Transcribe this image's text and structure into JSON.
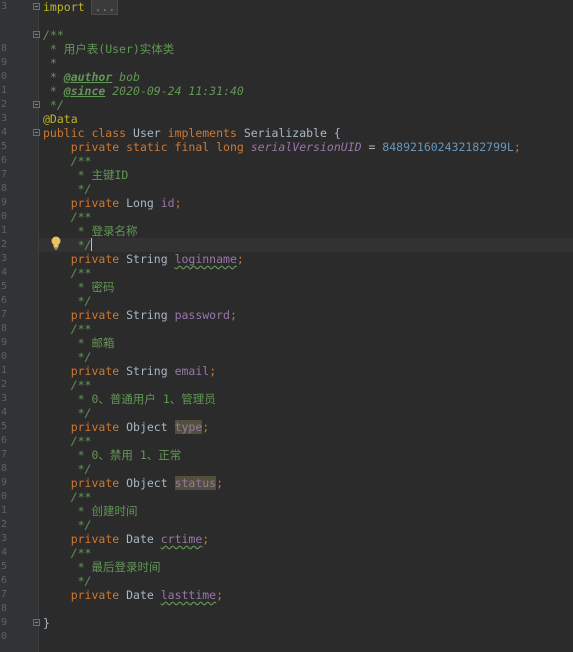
{
  "editor": {
    "line_numbers": [
      "3",
      "",
      "",
      "8",
      "9",
      "0",
      "1",
      "2",
      "3",
      "4",
      "5",
      "6",
      "7",
      "8",
      "9",
      "0",
      "1",
      "2",
      "3",
      "4",
      "5",
      "6",
      "7",
      "8",
      "9",
      "0",
      "1",
      "2",
      "3",
      "4",
      "5",
      "6",
      "7",
      "8",
      "9",
      "0",
      "1",
      "2",
      "3",
      "4",
      "5",
      "6",
      "7",
      "8",
      "9",
      "0"
    ],
    "colors": {
      "background": "#2b2b2b",
      "keyword": "#cc7832",
      "annotation": "#bbb529",
      "doc_comment": "#629755",
      "field": "#9876aa",
      "number": "#6897bb"
    }
  },
  "code": {
    "import_kw": "import",
    "import_fold": "...",
    "doc_open": "/**",
    "doc_title": " * 用户表(User)实体类",
    "doc_blank": " *",
    "doc_author_tag": "@author",
    "doc_author_val": " bob",
    "doc_since_tag": "@since",
    "doc_since_val": " 2020-09-24 11:31:40",
    "doc_close": " */",
    "annotation": "@Data",
    "class_kw1": "public class",
    "class_name": " User ",
    "class_kw2": "implements",
    "class_iface": " Serializable {",
    "serial_kw": "private static final long",
    "serial_name": "serialVersionUID",
    "serial_eq": " = ",
    "serial_val": "848921602432182799L",
    "semicolon": ";",
    "c_open": "/**",
    "c_close": " */",
    "c_id": " * 主键ID",
    "c_loginname": " * 登录名称",
    "c_password": " * 密码",
    "c_email": " * 邮箱",
    "c_type": " * 0、普通用户 1、管理员",
    "c_status": " * 0、禁用 1、正常",
    "c_crtime": " * 创建时间",
    "c_lasttime": " * 最后登录时间",
    "kw_private": "private",
    "t_long": " Long ",
    "t_string": " String ",
    "t_object": " Object ",
    "t_date": " Date ",
    "f_id": "id",
    "f_loginname": "loginname",
    "f_password": "password",
    "f_email": "email",
    "f_type": "type",
    "f_status": "status",
    "f_crtime": "crtime",
    "f_lasttime": "lasttime",
    "class_close": "}"
  },
  "icons": {
    "bulb": "lightbulb-icon"
  }
}
